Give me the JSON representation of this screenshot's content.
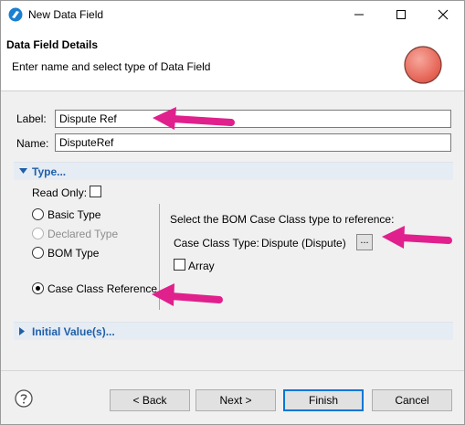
{
  "window": {
    "title": "New Data Field"
  },
  "header": {
    "title": "Data Field Details",
    "description": "Enter name and select type of Data Field"
  },
  "form": {
    "label_caption": "Label:",
    "label_value": "Dispute Ref",
    "name_caption": "Name:",
    "name_value": "DisputeRef"
  },
  "type_section": {
    "title": "Type...",
    "read_only_label": "Read Only:",
    "options": {
      "basic": "Basic Type",
      "declared": "Declared Type",
      "bom": "BOM Type",
      "case_class": "Case Class Reference"
    },
    "selected_option": "Case Class Reference",
    "prompt": "Select the BOM Case Class type to reference:",
    "case_class_label": "Case Class Type:",
    "case_class_value": "Dispute (Dispute)",
    "browse_label": "...",
    "array_label": "Array"
  },
  "initial_values_section": {
    "title": "Initial Value(s)..."
  },
  "buttons": {
    "back": "< Back",
    "next": "Next >",
    "finish": "Finish",
    "cancel": "Cancel"
  },
  "colors": {
    "section_header_bg": "#e6ecf4",
    "section_title": "#1f5fa8",
    "annotation_arrow": "#e0208c",
    "default_button_border": "#0078d7"
  },
  "icons": [
    "app-logo-icon",
    "minimize-icon",
    "maximize-icon",
    "close-icon",
    "wizard-graphic-icon",
    "expand-triangle-icon",
    "collapse-triangle-icon",
    "help-icon",
    "annotation-arrow"
  ]
}
